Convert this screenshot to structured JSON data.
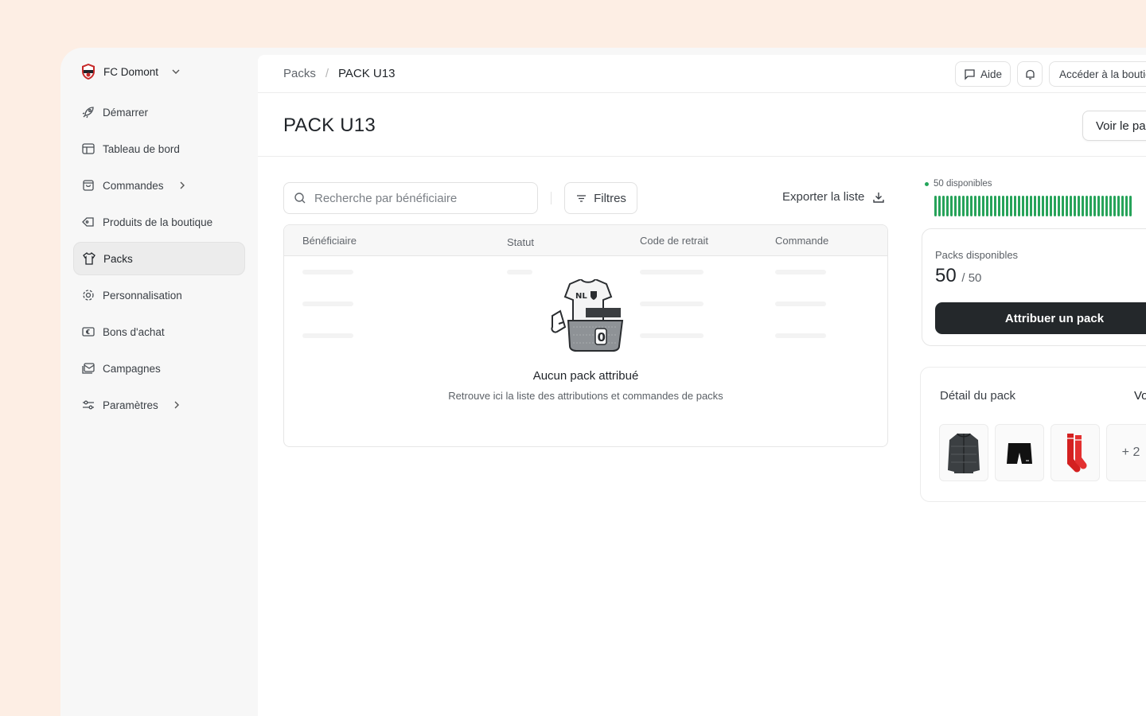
{
  "club": {
    "name": "FC Domont"
  },
  "nav": {
    "items": [
      {
        "label": "Démarrer"
      },
      {
        "label": "Tableau de bord"
      },
      {
        "label": "Commandes"
      },
      {
        "label": "Produits de la boutique"
      },
      {
        "label": "Packs",
        "active": true
      },
      {
        "label": "Personnalisation"
      },
      {
        "label": "Bons d'achat"
      },
      {
        "label": "Campagnes"
      },
      {
        "label": "Paramètres"
      }
    ]
  },
  "breadcrumb": {
    "parent": "Packs",
    "separator": "/",
    "current": "PACK U13"
  },
  "topbar": {
    "help_label": "Aide",
    "shop_label": "Accéder à la boutique"
  },
  "page": {
    "title": "PACK U13",
    "view_button": "Voir le pack"
  },
  "search": {
    "placeholder": "Recherche par bénéficiaire"
  },
  "filters_label": "Filtres",
  "export_label": "Exporter la liste",
  "table": {
    "columns": [
      "Bénéficiaire",
      "Statut",
      "Code de retrait",
      "Commande"
    ],
    "rows": []
  },
  "empty_state": {
    "title": "Aucun pack attribué",
    "subtitle": "Retrouve ici la liste des attributions et commandes de packs"
  },
  "availability": {
    "tag": "50 disponibles",
    "available": 50,
    "total": 50,
    "color": "#27a35a"
  },
  "packs_card": {
    "label": "Packs disponibles",
    "count": "50",
    "total": "/ 50",
    "assign_button": "Attribuer un pack"
  },
  "detail": {
    "title": "Détail du pack",
    "link": "Voir",
    "items": [
      "jacket-thumbnail",
      "shorts-thumbnail",
      "socks-thumbnail"
    ],
    "more": "+ 2"
  },
  "colors": {
    "accent": "#24282b",
    "available": "#27a35a",
    "background": "#fdeee4"
  }
}
